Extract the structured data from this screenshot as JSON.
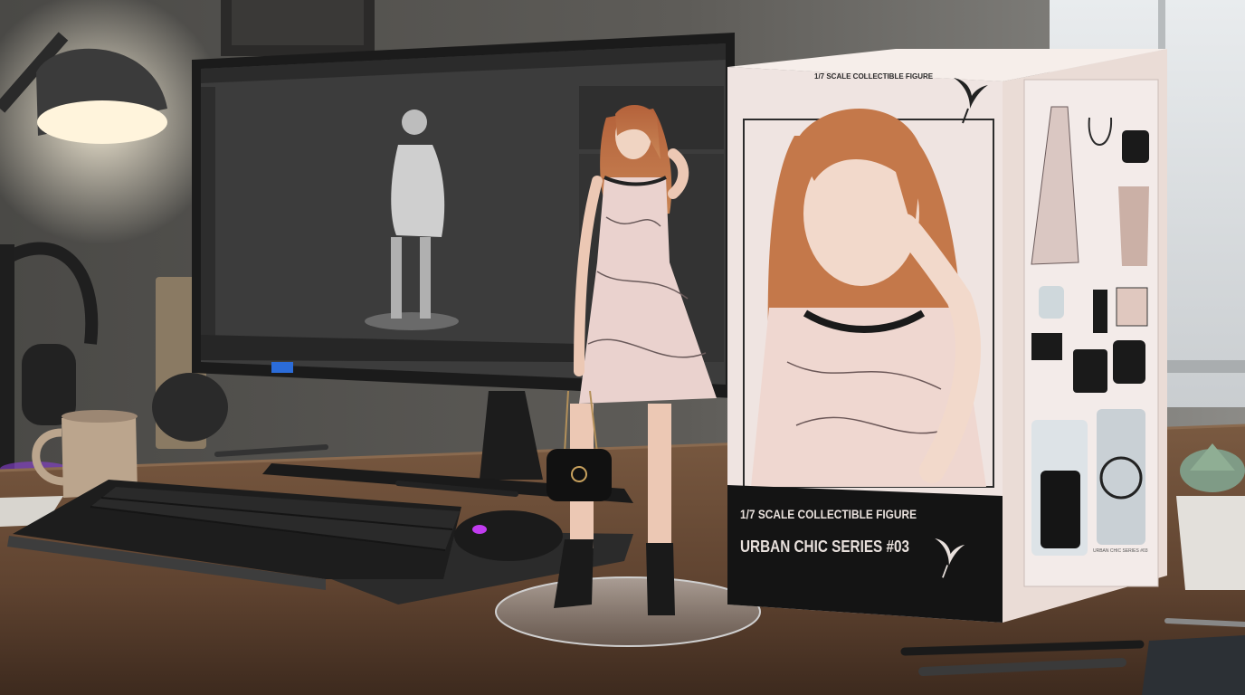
{
  "box": {
    "top_label": "1/7 SCALE COLLECTIBLE FIGURE",
    "bottom_line1": "1/7 SCALE COLLECTIBLE FIGURE",
    "bottom_line2": "URBAN CHIC SERIES #03",
    "side_caption": "URBAN CHIC SERIES #03"
  },
  "colors": {
    "wall": "#5b5a58",
    "desk": "#6b4a33",
    "box_pink": "#e9dcd9",
    "box_black": "#141414",
    "hair": "#b5673a",
    "dress": "#e8cfcb",
    "screen": "#3b3b3b",
    "lamp_glow": "#fff3de"
  },
  "icons": {
    "brand": "bird-logo-icon"
  }
}
